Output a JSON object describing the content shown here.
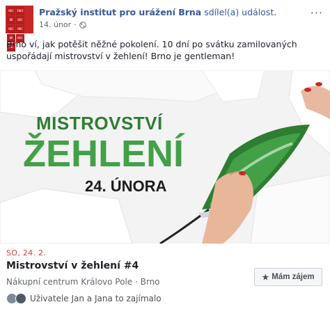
{
  "header": {
    "author": "Pražský institut pro urážení Brna",
    "action": "sdílel(a) událost.",
    "date": "14. únor",
    "separator": "·",
    "avatar_cells": [
      "NOI",
      "INGI",
      "BR",
      "NOI",
      "NOI",
      "NNI",
      "BR",
      "NOI",
      "ENI"
    ]
  },
  "post": {
    "text": "Brno ví, jak potěšit něžné pokolení. 10 dní po svátku zamilovaných uspořádají mistrovství v žehlení! Brno je gentleman!"
  },
  "cover": {
    "line1": "MISTROVSTVÍ",
    "line2": "ŽEHLENÍ",
    "line3": "24. ÚNORA"
  },
  "event": {
    "date": "SO, 24. 2.",
    "title": "Mistrovství v žehlení #4",
    "place": "Nákupní centrum Královo Pole · Brno",
    "interest_button": "Mám zájem",
    "friends_text": "Uživatele Jan a Jana to zajímalo"
  },
  "colors": {
    "link": "#365899",
    "green_dark": "#2e7d32",
    "green_light": "#43a047",
    "date_red": "#d23f3f"
  },
  "icons": {
    "privacy": "globe-icon",
    "star": "star-icon",
    "more": "more-icon"
  }
}
